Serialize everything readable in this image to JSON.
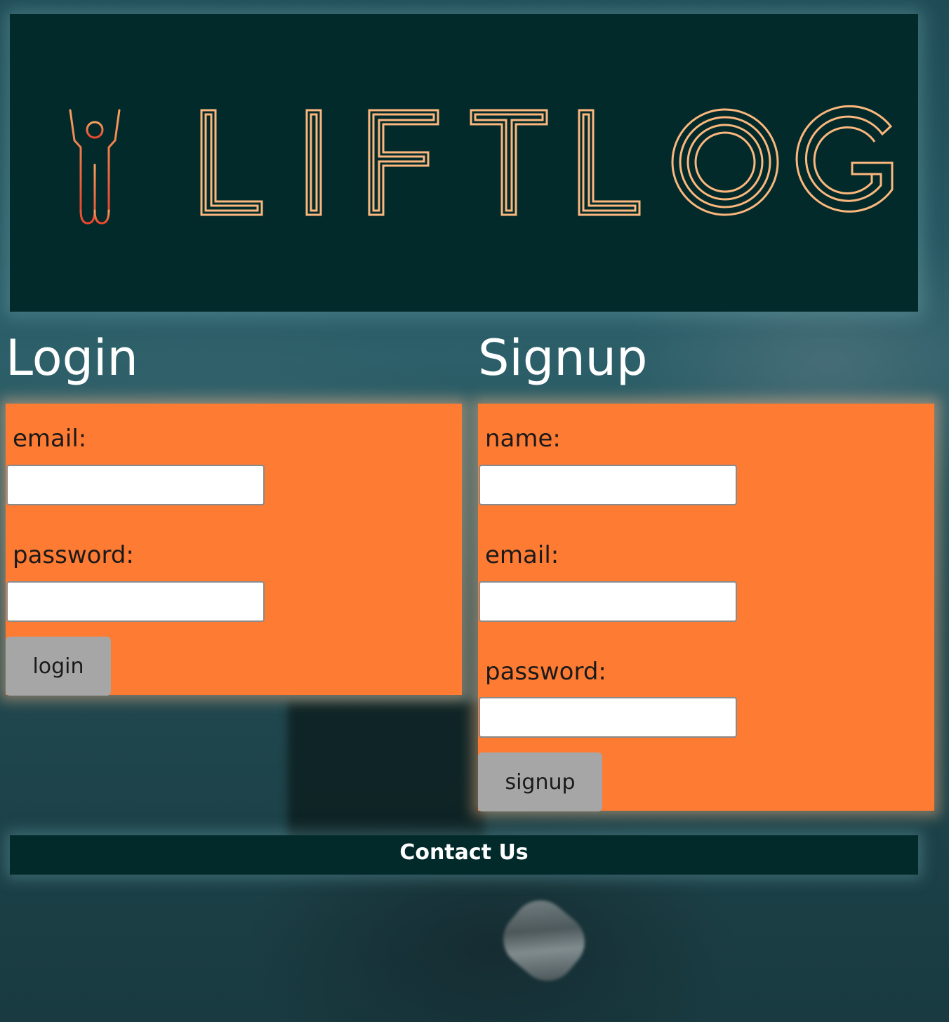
{
  "banner": {
    "logo_text": "LIFTLOG",
    "colors": {
      "background": "#032a2a",
      "logo": "#fbb77d",
      "figure": "#f27d2b"
    }
  },
  "login": {
    "title": "Login",
    "email_label": "email:",
    "email_value": "",
    "password_label": "password:",
    "password_value": "",
    "button_label": "login"
  },
  "signup": {
    "title": "Signup",
    "name_label": "name:",
    "name_value": "",
    "email_label": "email:",
    "email_value": "",
    "password_label": "password:",
    "password_value": "",
    "button_label": "signup"
  },
  "footer": {
    "contact_label": "Contact Us"
  },
  "theme": {
    "panel_color": "#fe7b33",
    "button_color": "#a6a6a6",
    "dark_teal": "#032a2a"
  }
}
